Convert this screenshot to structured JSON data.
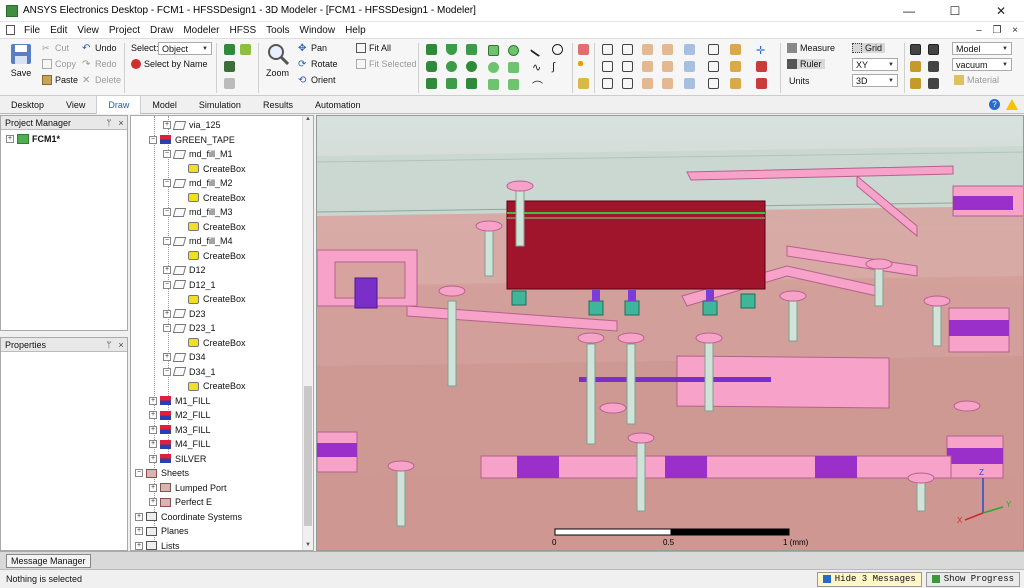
{
  "window": {
    "title": "ANSYS Electronics Desktop - FCM1 - HFSSDesign1 - 3D Modeler - [FCM1 - HFSSDesign1 - Modeler]",
    "controls": [
      "—",
      "☐",
      "✕"
    ]
  },
  "menu": {
    "items": [
      "File",
      "Edit",
      "View",
      "Project",
      "Draw",
      "Modeler",
      "HFSS",
      "Tools",
      "Window",
      "Help"
    ],
    "mdi_controls": [
      "–",
      "❐",
      "×"
    ]
  },
  "ribbon": {
    "save": "Save",
    "cut": "Cut",
    "copy": "Copy",
    "paste": "Paste",
    "undo": "Undo",
    "redo": "Redo",
    "delete": "Delete",
    "select_label": "Select:",
    "select_value": "Object",
    "select_by_name": "Select by Name",
    "zoom": "Zoom",
    "pan": "Pan",
    "rotate": "Rotate",
    "orient": "Orient",
    "fit_all": "Fit All",
    "fit_selected": "Fit Selected",
    "measure": "Measure",
    "ruler": "Ruler",
    "units": "Units",
    "grid": "Grid",
    "plane": "XY",
    "dim": "3D",
    "model_combo": "Model",
    "material_combo": "vacuum",
    "material_btn": "Material"
  },
  "tabs": [
    "Desktop",
    "View",
    "Draw",
    "Model",
    "Simulation",
    "Results",
    "Automation"
  ],
  "active_tab": "Draw",
  "project_manager": {
    "title": "Project Manager",
    "pin": "ᛘ",
    "close": "×",
    "project": "FCM1*"
  },
  "properties": {
    "title": "Properties",
    "pin": "ᛘ",
    "close": "×"
  },
  "tree": [
    {
      "label": "via_125",
      "level": 2,
      "icon": "box",
      "exp": "+"
    },
    {
      "label": "GREEN_TAPE",
      "level": 1,
      "icon": "mat",
      "exp": "−"
    },
    {
      "label": "md_fill_M1",
      "level": 2,
      "icon": "box",
      "exp": "−"
    },
    {
      "label": "CreateBox",
      "level": 3,
      "icon": "create",
      "exp": ""
    },
    {
      "label": "md_fill_M2",
      "level": 2,
      "icon": "box",
      "exp": "−"
    },
    {
      "label": "CreateBox",
      "level": 3,
      "icon": "create",
      "exp": ""
    },
    {
      "label": "md_fill_M3",
      "level": 2,
      "icon": "box",
      "exp": "−"
    },
    {
      "label": "CreateBox",
      "level": 3,
      "icon": "create",
      "exp": ""
    },
    {
      "label": "md_fill_M4",
      "level": 2,
      "icon": "box",
      "exp": "−"
    },
    {
      "label": "CreateBox",
      "level": 3,
      "icon": "create",
      "exp": ""
    },
    {
      "label": "D12",
      "level": 2,
      "icon": "box",
      "exp": "+"
    },
    {
      "label": "D12_1",
      "level": 2,
      "icon": "box",
      "exp": "−"
    },
    {
      "label": "CreateBox",
      "level": 3,
      "icon": "create",
      "exp": ""
    },
    {
      "label": "D23",
      "level": 2,
      "icon": "box",
      "exp": "+"
    },
    {
      "label": "D23_1",
      "level": 2,
      "icon": "box",
      "exp": "−"
    },
    {
      "label": "CreateBox",
      "level": 3,
      "icon": "create",
      "exp": ""
    },
    {
      "label": "D34",
      "level": 2,
      "icon": "box",
      "exp": "+"
    },
    {
      "label": "D34_1",
      "level": 2,
      "icon": "box",
      "exp": "−"
    },
    {
      "label": "CreateBox",
      "level": 3,
      "icon": "create",
      "exp": ""
    },
    {
      "label": "M1_FILL",
      "level": 1,
      "icon": "mat",
      "exp": "+"
    },
    {
      "label": "M2_FILL",
      "level": 1,
      "icon": "mat",
      "exp": "+"
    },
    {
      "label": "M3_FILL",
      "level": 1,
      "icon": "mat",
      "exp": "+"
    },
    {
      "label": "M4_FILL",
      "level": 1,
      "icon": "mat",
      "exp": "+"
    },
    {
      "label": "SILVER",
      "level": 1,
      "icon": "mat",
      "exp": "+"
    },
    {
      "label": "Sheets",
      "level": 0,
      "icon": "sheet",
      "exp": "−"
    },
    {
      "label": "Lumped Port",
      "level": 1,
      "icon": "sheet",
      "exp": "+"
    },
    {
      "label": "Perfect E",
      "level": 1,
      "icon": "sheet",
      "exp": "+"
    },
    {
      "label": "Coordinate Systems",
      "level": 0,
      "icon": "generic",
      "exp": "+"
    },
    {
      "label": "Planes",
      "level": 0,
      "icon": "generic",
      "exp": "+"
    },
    {
      "label": "Lists",
      "level": 0,
      "icon": "generic",
      "exp": "+"
    }
  ],
  "viewport": {
    "scale_labels": [
      "0",
      "0.5",
      "1 (mm)"
    ],
    "axis_labels": [
      "Z",
      "Y",
      "X"
    ]
  },
  "message_manager": "Message Manager",
  "status": {
    "text": "Nothing is selected",
    "hide_messages": "Hide 3 Messages",
    "show_progress": "Show Progress"
  }
}
